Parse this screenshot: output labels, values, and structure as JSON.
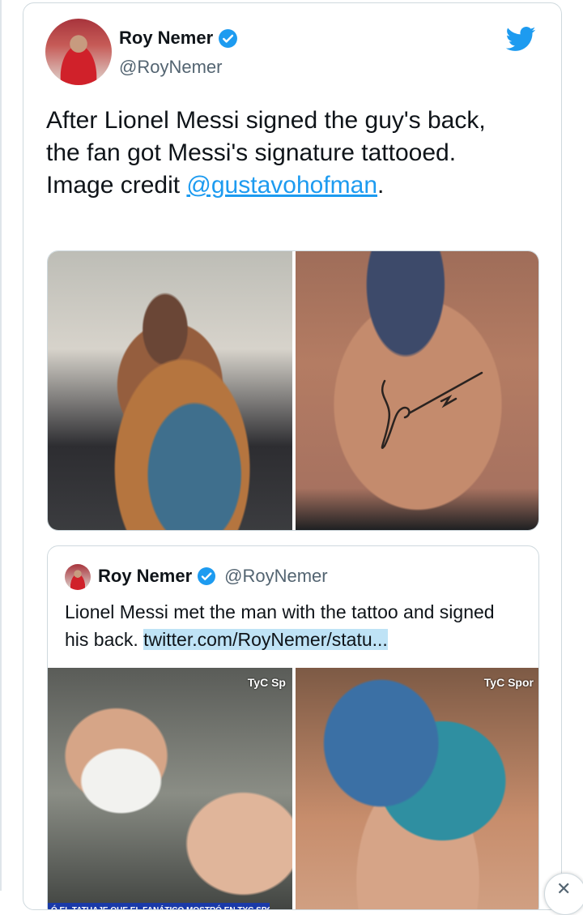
{
  "tweet": {
    "display_name": "Roy Nemer",
    "handle": "@RoyNemer",
    "text_before": "After Lionel Messi signed the guy's back, the fan got Messi's signature tattooed. Image credit ",
    "mention": "@gustavohofman",
    "text_after": "."
  },
  "quoted": {
    "display_name": "Roy Nemer",
    "handle": "@RoyNemer",
    "text": "Lionel Messi met the man with the tattoo and signed his back. ",
    "link": "twitter.com/RoyNemer/statu...",
    "watermark_left": "TyC Sp",
    "watermark_right": "TyC Spor",
    "caption": "Ó EL TATUAJE QUE EL FANÁTICO MOSTRÓ EN TYC SPORTS"
  },
  "icons": {
    "verified": "verified-badge-icon",
    "bird": "twitter-bird-icon",
    "close": "close-icon"
  },
  "colors": {
    "accent": "#1d9bf0",
    "text": "#0f1419",
    "muted": "#536471",
    "border": "#cfd9de"
  }
}
